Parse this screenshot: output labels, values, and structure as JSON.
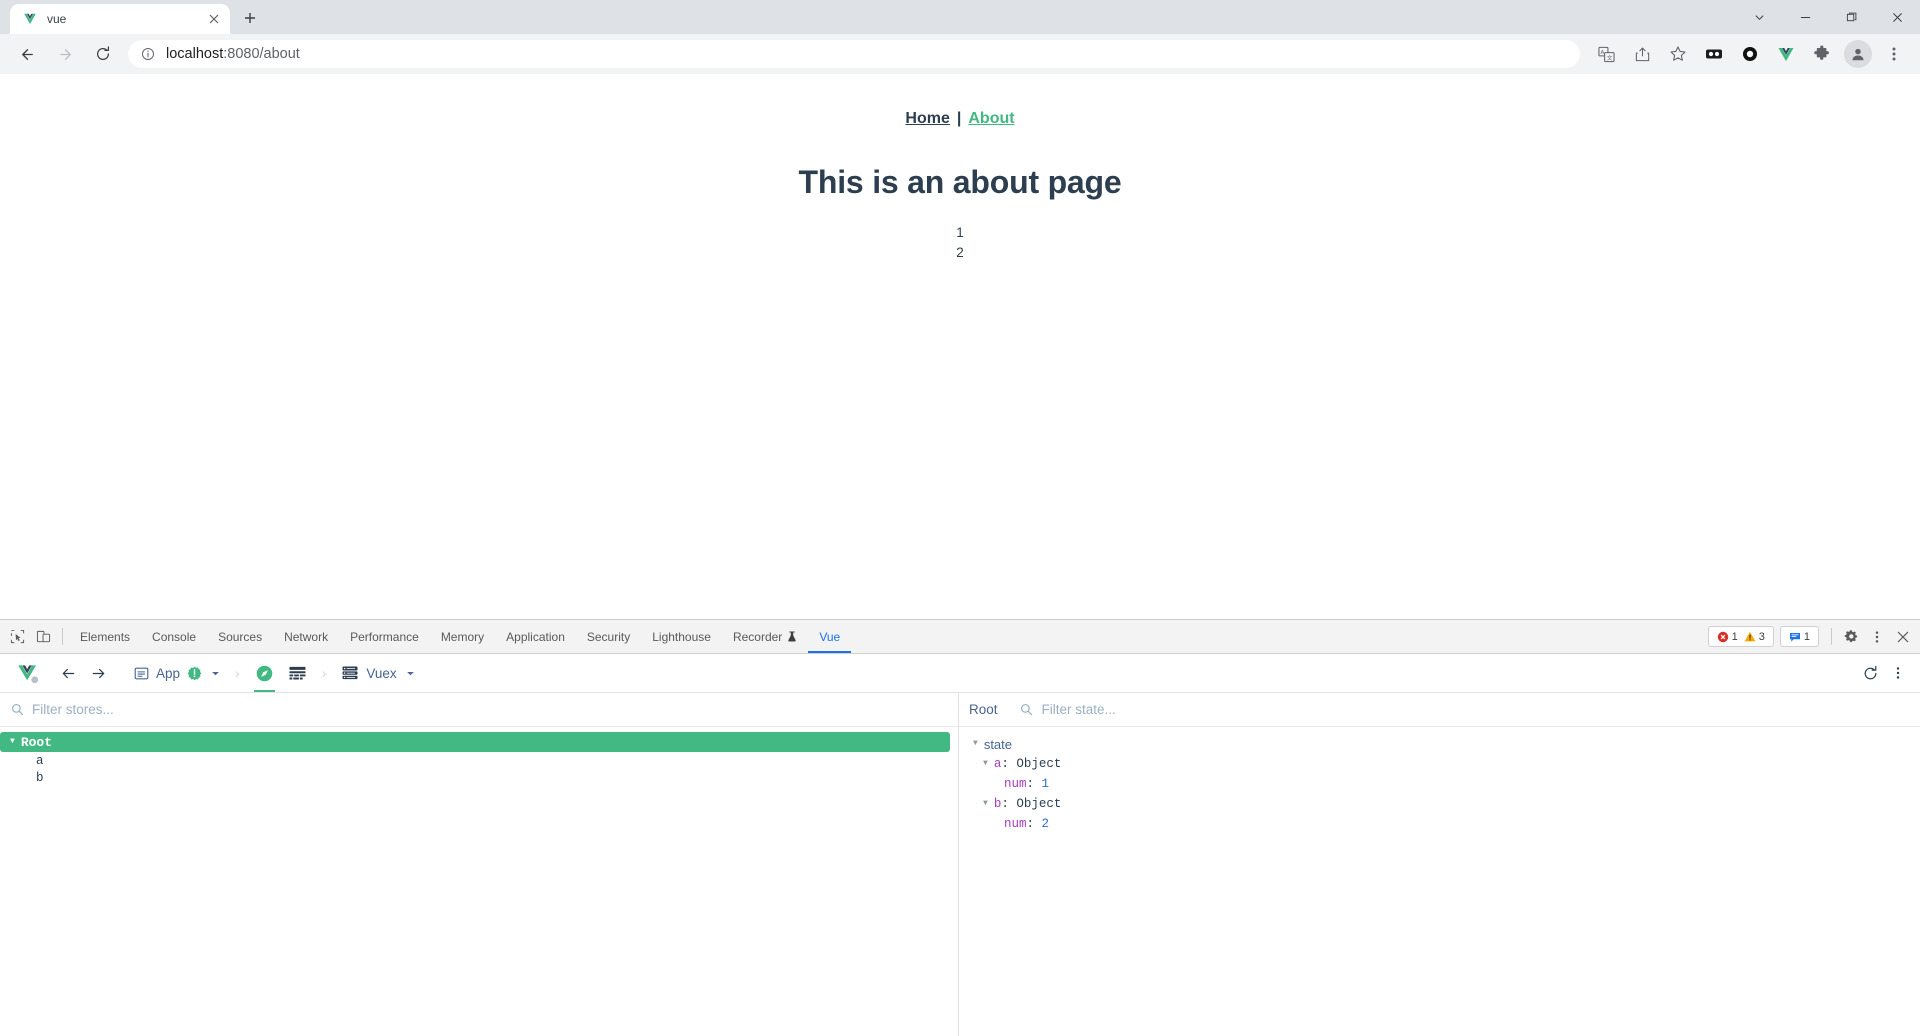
{
  "browser": {
    "tab": {
      "title": "vue",
      "favicon": "vue-logo-icon",
      "close": "×"
    },
    "new_tab_label": "+",
    "window_controls": [
      "tab-search-chevron",
      "minimize",
      "maximize",
      "close"
    ],
    "nav": {
      "back": "back-arrow",
      "forward": "forward-arrow",
      "reload": "reload"
    },
    "omnibox": {
      "info_icon": "info-circle",
      "host": "localhost",
      "path": ":8080/about",
      "full_url": "localhost:8080/about"
    },
    "toolbar_icons": [
      "translate-icon",
      "share-icon",
      "bookmark-star-icon",
      "lastpass-extension-icon",
      "circle-extension-icon",
      "vue-devtools-extension-icon",
      "extensions-puzzle-icon",
      "profile-avatar-icon",
      "chrome-menu-icon"
    ]
  },
  "page": {
    "nav_links": [
      {
        "label": "Home",
        "active": false
      },
      {
        "label": "About",
        "active": true
      }
    ],
    "nav_separator": "|",
    "heading": "This is an about page",
    "values": [
      "1",
      "2"
    ],
    "accent_color": "#42b983",
    "text_color": "#2c3e50"
  },
  "devtools": {
    "left_icons": [
      "inspect-element-icon",
      "device-toolbar-icon"
    ],
    "tabs": [
      {
        "label": "Elements",
        "active": false
      },
      {
        "label": "Console",
        "active": false
      },
      {
        "label": "Sources",
        "active": false
      },
      {
        "label": "Network",
        "active": false
      },
      {
        "label": "Performance",
        "active": false
      },
      {
        "label": "Memory",
        "active": false
      },
      {
        "label": "Application",
        "active": false
      },
      {
        "label": "Security",
        "active": false
      },
      {
        "label": "Lighthouse",
        "active": false
      },
      {
        "label": "Recorder",
        "active": false,
        "badge": "recorder-flask-icon"
      },
      {
        "label": "Vue",
        "active": true
      }
    ],
    "counters": {
      "errors": "1",
      "warnings": "3",
      "messages": "1"
    },
    "right_icons": [
      "settings-gear-icon",
      "devtools-menu-icon",
      "close-devtools-icon"
    ],
    "active_tab_color": "#1a73e8"
  },
  "vue_panel": {
    "toolbar": {
      "logo": "vue-logo-icon",
      "back": "back-arrow",
      "forward": "forward-arrow",
      "app_selector": {
        "icon": "app-window-icon",
        "label": "App",
        "badge": "update-available-badge",
        "caret": "▾"
      },
      "separator": "›",
      "inspector_icon": "components-compass-icon",
      "timeline_icon": "timeline-icon",
      "plugin_selector": {
        "icon": "vuex-list-icon",
        "label": "Vuex",
        "caret": "▾"
      },
      "right_icons": [
        "refresh-icon",
        "vue-panel-menu-icon"
      ]
    },
    "stores_pane": {
      "filter_placeholder": "Filter stores...",
      "filter_value": "",
      "tree": [
        {
          "label": "Root",
          "selected": true,
          "expanded": true,
          "children": [
            {
              "label": "a"
            },
            {
              "label": "b"
            }
          ]
        }
      ]
    },
    "state_pane": {
      "title": "Root",
      "filter_placeholder": "Filter state...",
      "filter_value": "",
      "tree": [
        {
          "group": "state",
          "expanded": true,
          "entries": [
            {
              "key": "a",
              "type": "Object",
              "expanded": true,
              "props": [
                {
                  "key": "num",
                  "value": "1"
                }
              ]
            },
            {
              "key": "b",
              "type": "Object",
              "expanded": true,
              "props": [
                {
                  "key": "num",
                  "value": "2"
                }
              ]
            }
          ]
        }
      ]
    },
    "colors": {
      "selected_row": "#42b983",
      "key": "#a63bc5",
      "number": "#2b6cd4",
      "label": "#486491"
    }
  }
}
